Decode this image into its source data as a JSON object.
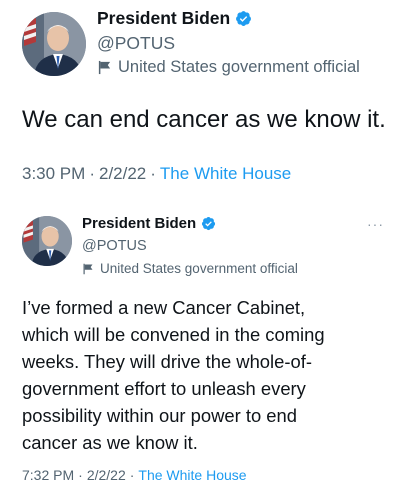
{
  "tweets": [
    {
      "author_name": "President Biden",
      "handle": "@POTUS",
      "label": "United States government official",
      "text": "We can end cancer as we know it.",
      "time": "3:30 PM",
      "date": "2/2/22",
      "source": "The White House",
      "icons": [
        "avatar",
        "verified-badge-icon",
        "government-flag-icon"
      ]
    },
    {
      "author_name": "President Biden",
      "handle": "@POTUS",
      "label": "United States government official",
      "text": "I’ve formed a new Cancer Cabinet,\nwhich will be convened in the coming\nweeks. They will drive the whole-of-\ngovernment effort to unleash every\npossibility within our power to end\ncancer as we know it.",
      "time": "7:32 PM",
      "date": "2/2/22",
      "source": "The White House",
      "more_label": "···",
      "icons": [
        "avatar",
        "verified-badge-icon",
        "government-flag-icon",
        "more-options-icon"
      ]
    }
  ],
  "separator": "·",
  "colors": {
    "accent": "#1d9bf0",
    "secondary_text": "#536471",
    "primary_text": "#0f1419",
    "verified_badge": "#1d9bf0"
  }
}
